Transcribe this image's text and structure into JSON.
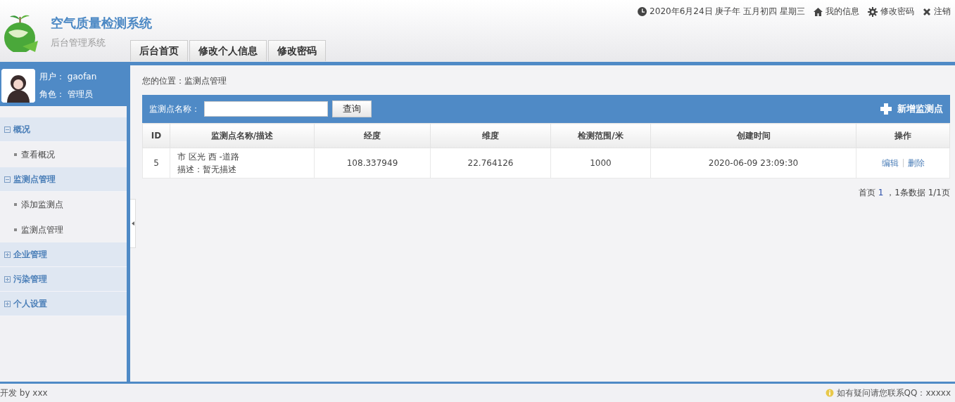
{
  "header": {
    "title": "空气质量检测系统",
    "subtitle": "后台管理系统",
    "tabs": [
      "后台首页",
      "修改个人信息",
      "修改密码"
    ],
    "date": "2020年6月24日 庚子年 五月初四 星期三",
    "links": [
      {
        "kind": "home",
        "label": "我的信息"
      },
      {
        "kind": "gear",
        "label": "修改密码"
      },
      {
        "kind": "close",
        "label": "注销"
      }
    ]
  },
  "sidebar": {
    "user": [
      {
        "label": "用户：",
        "value": "gaofan"
      },
      {
        "label": "角色：",
        "value": "管理员"
      }
    ],
    "items": [
      {
        "label": "概况",
        "expanded": true,
        "children": [
          {
            "label": "查看概况"
          }
        ]
      },
      {
        "label": "监测点管理",
        "expanded": true,
        "children": [
          {
            "label": "添加监测点"
          },
          {
            "label": "监测点管理"
          }
        ]
      },
      {
        "label": "企业管理",
        "expanded": false
      },
      {
        "label": "污染管理",
        "expanded": false
      },
      {
        "label": "个人设置",
        "expanded": false
      }
    ]
  },
  "main": {
    "breadcrumb": "您的位置：监测点管理",
    "search": {
      "label": "监测点名称：",
      "button": "查询"
    },
    "add_button": "新增监测点",
    "table": {
      "columns": [
        "ID",
        "监测点名称/描述",
        "经度",
        "维度",
        "检测范围/米",
        "创建时间",
        "操作"
      ],
      "rows": [
        {
          "id": "5",
          "name": "市 区光 西 -道路",
          "description": "描述：暂无描述",
          "longitude": "108.337949",
          "latitude": "22.764126",
          "range": "1000",
          "created": "2020-06-09 23:09:30",
          "actions": [
            "编辑",
            "删除"
          ]
        }
      ]
    },
    "pager": {
      "first": "首页",
      "page": "1",
      "info": "，1条数据 1/1页"
    }
  },
  "footer": {
    "left": "开发 by xxx",
    "right": "如有疑问请您联系QQ：xxxxx"
  }
}
